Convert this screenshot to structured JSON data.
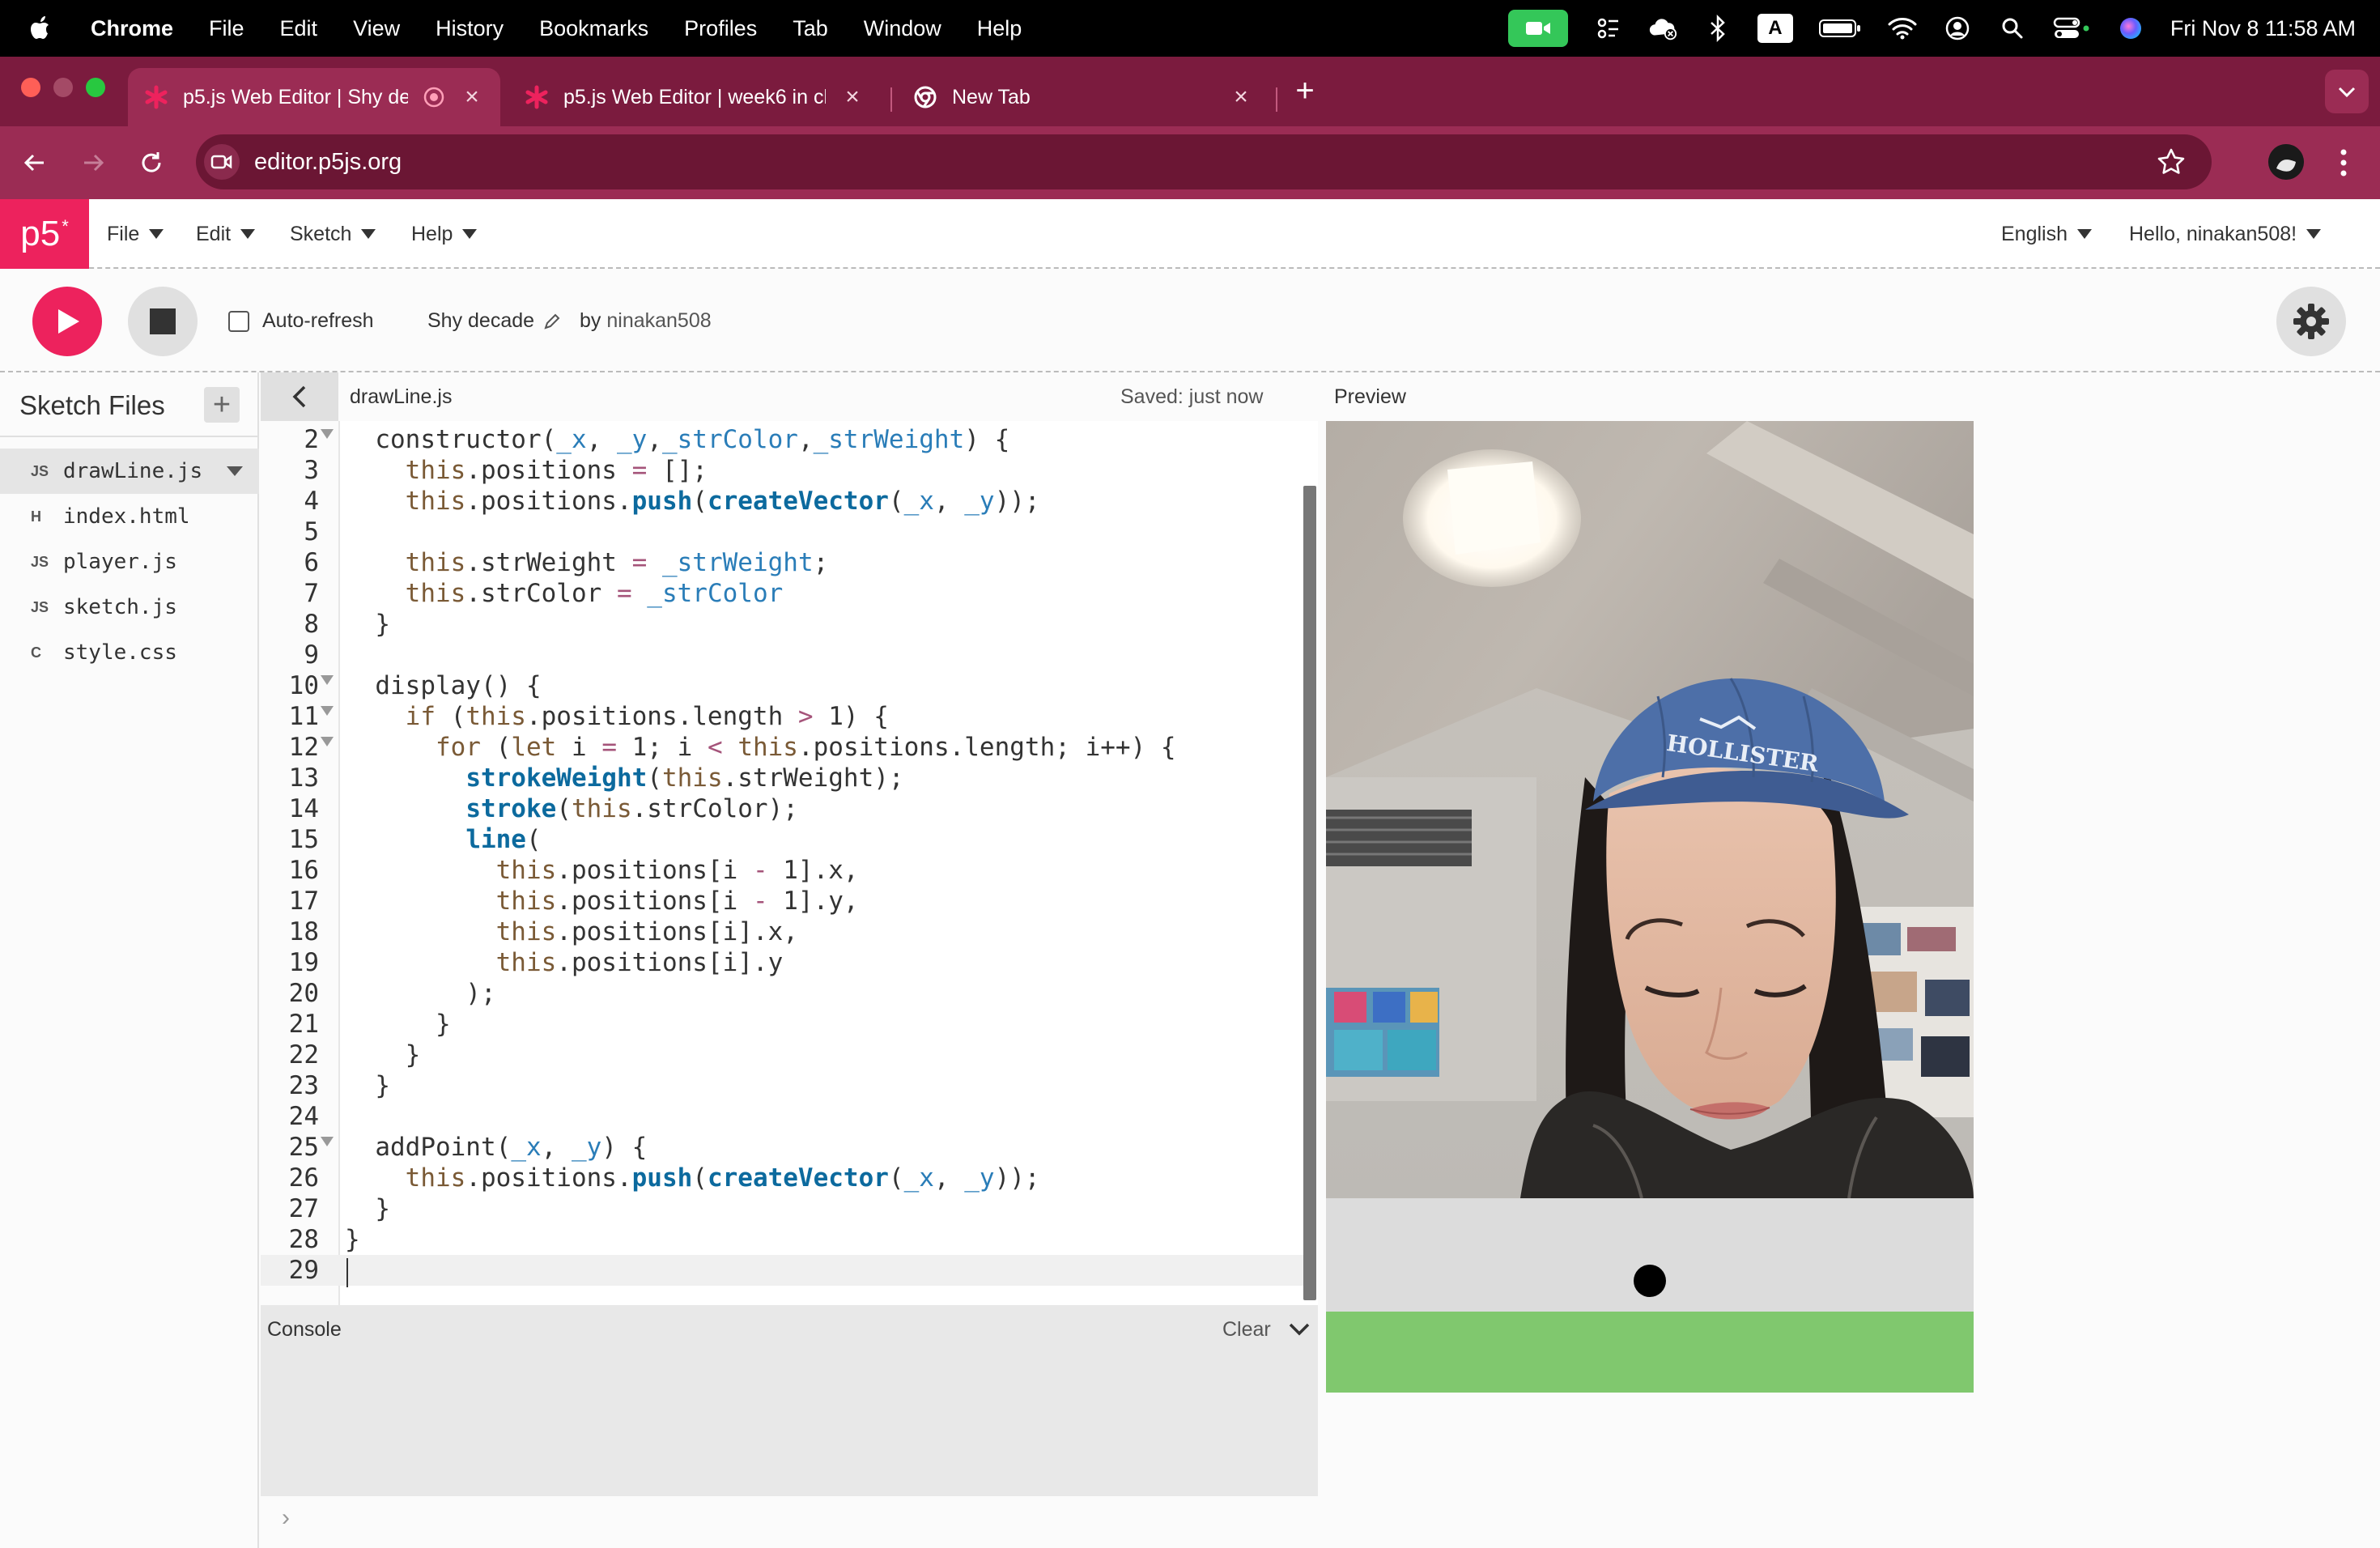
{
  "menubar": {
    "app": "Chrome",
    "items": [
      "File",
      "Edit",
      "View",
      "History",
      "Bookmarks",
      "Profiles",
      "Tab",
      "Window",
      "Help"
    ],
    "clock": "Fri Nov 8  11:58 AM",
    "status_icons": [
      "facetime-icon",
      "control-icon",
      "icloud-icon",
      "bluetooth-icon",
      "keyboard-input-icon",
      "battery-icon",
      "wifi-icon",
      "user-icon",
      "spotlight-icon",
      "control-center-icon",
      "siri-icon"
    ],
    "input_letter": "A"
  },
  "browser": {
    "tabs": [
      {
        "title": "p5.js Web Editor | Shy dec",
        "active": true
      },
      {
        "title": "p5.js Web Editor | week6 in cl",
        "active": false
      },
      {
        "title": "New Tab",
        "active": false
      }
    ],
    "url": "editor.p5js.org",
    "colors": {
      "frame": "#7b1b3e",
      "toolbar": "#9b2c54"
    }
  },
  "p5": {
    "logo": "p5",
    "logo_mark": "*",
    "menus": {
      "file": "File",
      "edit": "Edit",
      "sketch": "Sketch",
      "help": "Help"
    },
    "language": "English",
    "greeting": "Hello, ninakan508!",
    "autorefresh_label": "Auto-refresh",
    "sketch_name": "Shy decade",
    "by_label": "by",
    "author": "ninakan508",
    "accent": "#ed225d"
  },
  "sidebar": {
    "title": "Sketch Files",
    "add_label": "+",
    "files": [
      {
        "name": "drawLine.js",
        "icon": "JS",
        "active": true
      },
      {
        "name": "index.html",
        "icon": "H",
        "active": false
      },
      {
        "name": "player.js",
        "icon": "JS",
        "active": false
      },
      {
        "name": "sketch.js",
        "icon": "JS",
        "active": false
      },
      {
        "name": "style.css",
        "icon": "C",
        "active": false
      }
    ]
  },
  "editor": {
    "filename": "drawLine.js",
    "save_status": "Saved: just now",
    "lines": [
      {
        "n": "2",
        "code": "  constructor(_x, _y,_strColor,_strWeight) {",
        "fold": true
      },
      {
        "n": "3",
        "code": "    this.positions = [];"
      },
      {
        "n": "4",
        "code": "    this.positions.push(createVector(_x, _y));"
      },
      {
        "n": "5",
        "code": ""
      },
      {
        "n": "6",
        "code": "    this.strWeight = _strWeight;"
      },
      {
        "n": "7",
        "code": "    this.strColor = _strColor"
      },
      {
        "n": "8",
        "code": "  }"
      },
      {
        "n": "9",
        "code": ""
      },
      {
        "n": "10",
        "code": "  display() {",
        "fold": true
      },
      {
        "n": "11",
        "code": "    if (this.positions.length > 1) {",
        "fold": true
      },
      {
        "n": "12",
        "code": "      for (let i = 1; i < this.positions.length; i++) {",
        "fold": true
      },
      {
        "n": "13",
        "code": "        strokeWeight(this.strWeight);"
      },
      {
        "n": "14",
        "code": "        stroke(this.strColor);"
      },
      {
        "n": "15",
        "code": "        line("
      },
      {
        "n": "16",
        "code": "          this.positions[i - 1].x,"
      },
      {
        "n": "17",
        "code": "          this.positions[i - 1].y,"
      },
      {
        "n": "18",
        "code": "          this.positions[i].x,"
      },
      {
        "n": "19",
        "code": "          this.positions[i].y"
      },
      {
        "n": "20",
        "code": "        );"
      },
      {
        "n": "21",
        "code": "      }"
      },
      {
        "n": "22",
        "code": "    }"
      },
      {
        "n": "23",
        "code": "  }"
      },
      {
        "n": "24",
        "code": ""
      },
      {
        "n": "25",
        "code": "  addPoint(_x, _y) {",
        "fold": true
      },
      {
        "n": "26",
        "code": "    this.positions.push(createVector(_x, _y));"
      },
      {
        "n": "27",
        "code": "  }"
      },
      {
        "n": "28",
        "code": "}"
      },
      {
        "n": "29",
        "code": "",
        "current": true
      }
    ]
  },
  "console": {
    "title": "Console",
    "clear_label": "Clear",
    "prompt": "›"
  },
  "preview": {
    "title": "Preview",
    "cap_text": "HOLLISTER",
    "colors": {
      "panel": "#dcdcdc",
      "ground": "#80c86e",
      "ball": "#000000"
    }
  }
}
